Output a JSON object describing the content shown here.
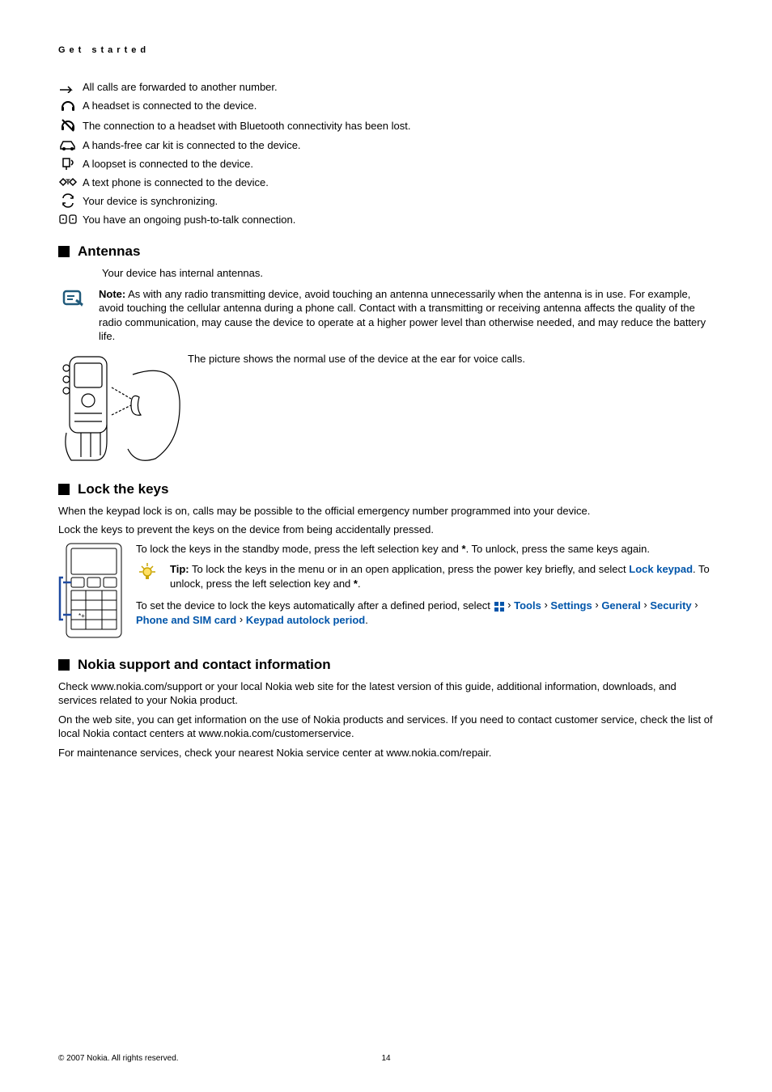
{
  "header": "Get started",
  "indicators": [
    {
      "icon": "forward-arrow-icon",
      "text": "All calls are forwarded to another number."
    },
    {
      "icon": "headset-icon",
      "text": "A headset is connected to the device."
    },
    {
      "icon": "headset-lost-icon",
      "text": "The connection to a headset with Bluetooth connectivity has been lost."
    },
    {
      "icon": "car-kit-icon",
      "text": "A hands-free car kit is connected to the device."
    },
    {
      "icon": "loopset-icon",
      "text": "A loopset is connected to the device."
    },
    {
      "icon": "textphone-icon",
      "text": "A text phone is connected to the device."
    },
    {
      "icon": "sync-icon",
      "text": "Your device is synchronizing."
    },
    {
      "icon": "ptt-icon",
      "text": "You have an ongoing push-to-talk connection."
    }
  ],
  "antennas": {
    "title": "Antennas",
    "intro": "Your device has internal antennas.",
    "note_label": "Note:",
    "note_body": "As with any radio transmitting device, avoid touching an antenna unnecessarily when the antenna is in use. For example, avoid touching the cellular antenna during a phone call. Contact with a transmitting or receiving antenna affects the quality of the radio communication, may cause the device to operate at a higher power level than otherwise needed, and may reduce the battery life.",
    "caption": "The picture shows the normal use of the device at the ear for voice calls."
  },
  "lock": {
    "title": "Lock the keys",
    "p1": "When the keypad lock is on, calls may be possible to the official emergency number programmed into your device.",
    "p2": "Lock the keys to prevent the keys on the device from being accidentally pressed.",
    "p3_a": "To lock the keys in the standby mode, press the left selection key and ",
    "p3_star": "*",
    "p3_b": ". To unlock, press the same keys again.",
    "tip_label": "Tip:",
    "tip_a": "To lock the keys in the menu or in an open application, press the power key briefly, and select ",
    "tip_link": "Lock keypad",
    "tip_b": ". To unlock, press the left selection key and ",
    "tip_star": "*",
    "tip_c": ".",
    "p4_a": "To set the device to lock the keys automatically after a defined period, select ",
    "p4_tools": "Tools",
    "p4_settings": "Settings",
    "p4_general": "General",
    "p4_security": "Security",
    "p4_phone": "Phone and SIM card",
    "p4_period": "Keypad autolock period",
    "p4_end": "."
  },
  "support": {
    "title": "Nokia support and contact information",
    "p1": "Check www.nokia.com/support or your local Nokia web site for the latest version of this guide, additional information, downloads, and services related to your Nokia product.",
    "p2": "On the web site, you can get information on the use of Nokia products and services. If you need to contact customer service, check the list of local Nokia contact centers at www.nokia.com/customerservice.",
    "p3": "For maintenance services, check your nearest Nokia service center at www.nokia.com/repair."
  },
  "footer": {
    "copyright": "© 2007 Nokia. All rights reserved.",
    "page": "14"
  },
  "chevron": "›"
}
